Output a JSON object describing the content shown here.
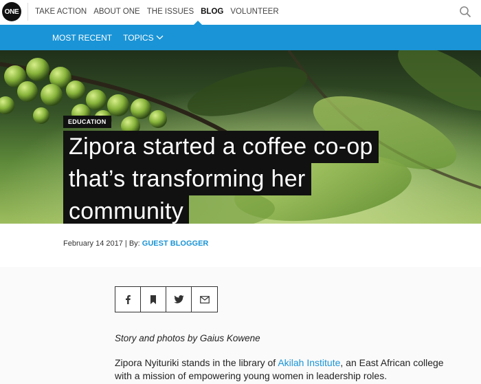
{
  "nav": {
    "logo": "ONE",
    "items": [
      "TAKE ACTION",
      "ABOUT ONE",
      "THE ISSUES",
      "BLOG",
      "VOLUNTEER"
    ],
    "active": "BLOG",
    "search_icon": "search-icon"
  },
  "subnav": {
    "most_recent": "MOST RECENT",
    "topics": "TOPICS"
  },
  "article": {
    "category": "EDUCATION",
    "title_lines": [
      "Zipora started a coffee co-op",
      "that’s transforming her",
      "community"
    ],
    "date": "February 14 2017",
    "by_label": "By:",
    "author": "GUEST BLOGGER",
    "share_icons": [
      "facebook-icon",
      "bookmark-icon",
      "twitter-icon",
      "email-icon"
    ],
    "byline": "Story and photos by Gaius Kowene",
    "para_before": "Zipora Nyituriki stands in the library of ",
    "para_link": "Akilah Institute",
    "para_after": ", an East African college with a mission of empowering young women in leadership roles."
  },
  "colors": {
    "accent": "#1a94d6",
    "dark": "#111111"
  }
}
